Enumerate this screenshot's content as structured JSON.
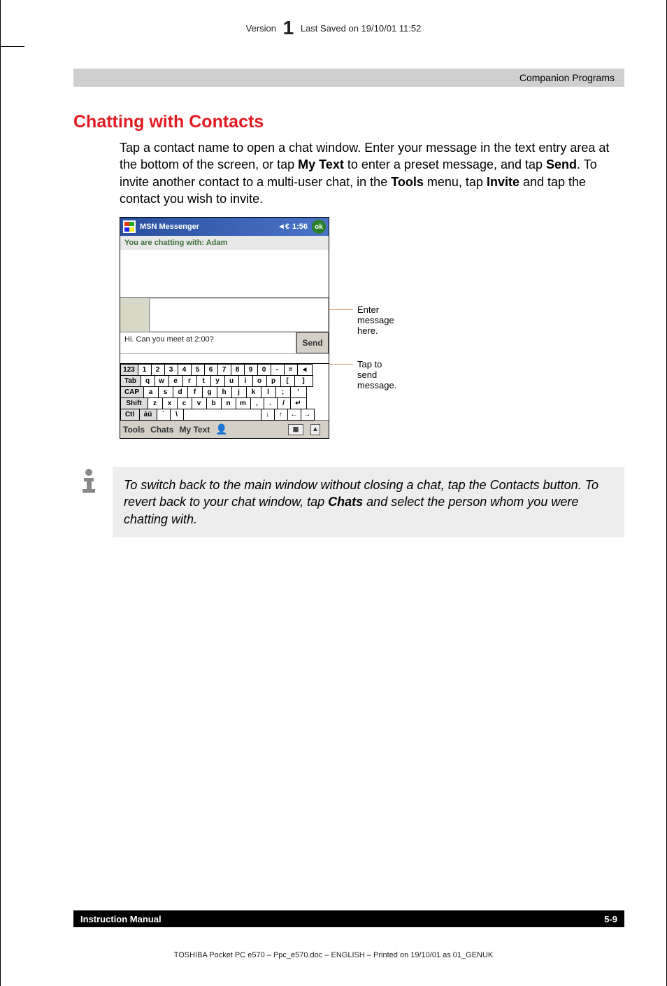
{
  "header": {
    "version_label": "Version",
    "version_number": "1",
    "saved_label": "Last Saved on 19/10/01 11:52"
  },
  "gray_bar": "Companion Programs",
  "section_title": "Chatting with Contacts",
  "body": {
    "p1_a": "Tap a contact name to open a chat window. Enter your message in the text entry area at the bottom of the screen, or tap ",
    "p1_b": "My Text",
    "p1_c": " to enter a preset message, and tap ",
    "p1_d": "Send",
    "p1_e": ". To invite another contact to a multi-user chat, in the ",
    "p1_f": "Tools",
    "p1_g": " menu, tap ",
    "p1_h": "Invite",
    "p1_i": " and tap the contact you wish to invite."
  },
  "screenshot": {
    "titlebar": {
      "app": "MSN Messenger",
      "sound": "◄€",
      "time": "1:56",
      "ok": "ok"
    },
    "chat_with": "You are chatting with: Adam",
    "message": "Hi. Can you meet at 2:00?",
    "send": "Send",
    "keyboard": {
      "row1": [
        "123",
        "1",
        "2",
        "3",
        "4",
        "5",
        "6",
        "7",
        "8",
        "9",
        "0",
        "-",
        "=",
        "◄"
      ],
      "row2": [
        "Tab",
        "q",
        "w",
        "e",
        "r",
        "t",
        "y",
        "u",
        "i",
        "o",
        "p",
        "[",
        "]"
      ],
      "row3": [
        "CAP",
        "a",
        "s",
        "d",
        "f",
        "g",
        "h",
        "j",
        "k",
        "l",
        ";",
        "'"
      ],
      "row4": [
        "Shift",
        "z",
        "x",
        "c",
        "v",
        "b",
        "n",
        "m",
        ",",
        ".",
        "/",
        "↵"
      ],
      "row5": [
        "Ctl",
        "áü",
        "`",
        "\\",
        "",
        "↓",
        "↑",
        "←",
        "→"
      ]
    },
    "bottombar": {
      "tools": "Tools",
      "chats": "Chats",
      "mytext": "My Text",
      "kb": "▦",
      "arrow": "▲"
    }
  },
  "callouts": {
    "c1": "Enter message here.",
    "c2": "Tap to send message."
  },
  "tip": {
    "t1": "To switch back to the main window without closing a chat, tap the Contacts button. To revert back to your chat window, tap ",
    "t2": "Chats",
    "t3": " and select the person whom you were chatting with."
  },
  "footer": {
    "left": "Instruction Manual",
    "right": "5-9",
    "line": "TOSHIBA Pocket PC e570  – Ppc_e570.doc – ENGLISH – Printed on 19/10/01 as 01_GENUK"
  }
}
